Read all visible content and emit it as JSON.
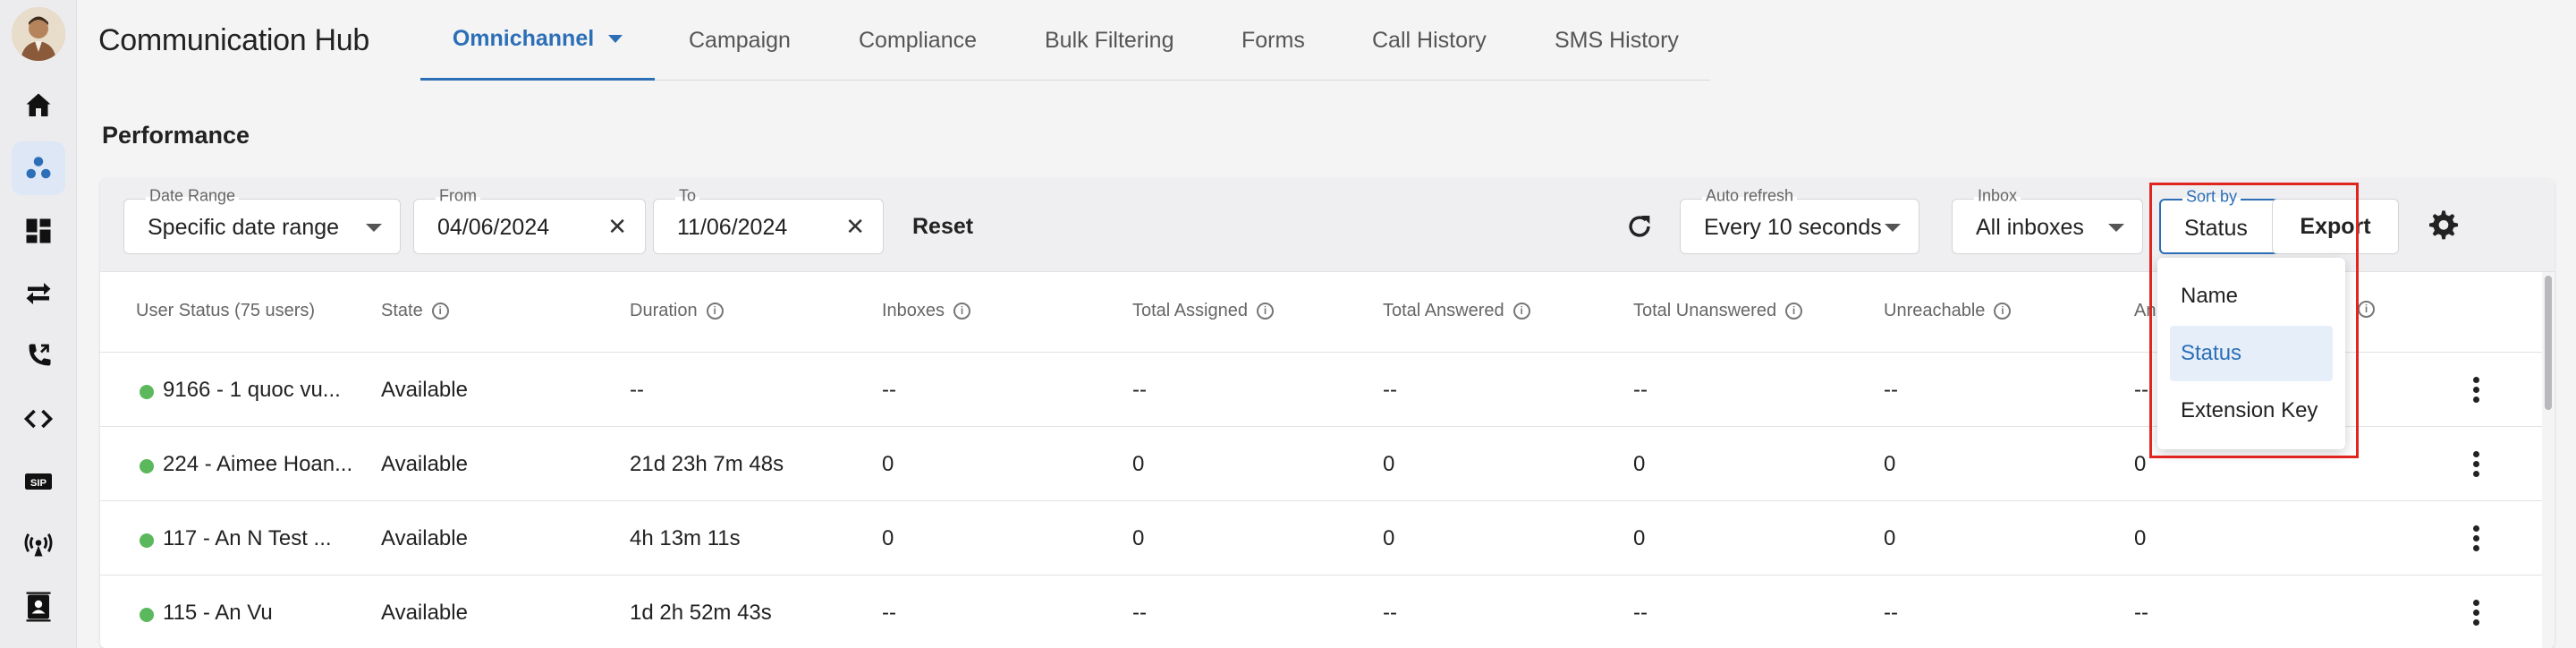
{
  "app": {
    "title": "Communication Hub"
  },
  "tabs": [
    {
      "label": "Omnichannel",
      "active": true
    },
    {
      "label": "Campaign"
    },
    {
      "label": "Compliance"
    },
    {
      "label": "Bulk Filtering"
    },
    {
      "label": "Forms"
    },
    {
      "label": "Call History"
    },
    {
      "label": "SMS History"
    }
  ],
  "sidebar": {
    "items": [
      {
        "icon": "home-icon"
      },
      {
        "icon": "omnichannel-icon",
        "active": true
      },
      {
        "icon": "dashboard-icon"
      },
      {
        "icon": "transfer-icon"
      },
      {
        "icon": "phone-forward-icon"
      },
      {
        "icon": "code-icon"
      },
      {
        "icon": "sip-icon",
        "text": "SIP"
      },
      {
        "icon": "broadcast-icon"
      },
      {
        "icon": "contacts-icon"
      }
    ]
  },
  "section": {
    "title": "Performance"
  },
  "filters": {
    "date_range": {
      "label": "Date Range",
      "value": "Specific date range"
    },
    "from": {
      "label": "From",
      "value": "04/06/2024"
    },
    "to": {
      "label": "To",
      "value": "11/06/2024"
    },
    "reset_label": "Reset",
    "auto_refresh": {
      "label": "Auto refresh",
      "value": "Every 10 seconds"
    },
    "inbox": {
      "label": "Inbox",
      "value": "All inboxes"
    },
    "sort_by": {
      "label": "Sort by",
      "value": "Status"
    },
    "export_label": "Export"
  },
  "sort_menu": {
    "options": [
      "Name",
      "Status",
      "Extension Key"
    ],
    "selected": "Status"
  },
  "table": {
    "headers": [
      "User Status (75 users)",
      "State",
      "Duration",
      "Inboxes",
      "Total Assigned",
      "Total Answered",
      "Total Unanswered",
      "Unreachable",
      "An"
    ],
    "rows": [
      {
        "user": "9166 - 1 quoc vu...",
        "state": "Available",
        "duration": "--",
        "inboxes": "--",
        "assigned": "--",
        "answered": "--",
        "unanswered": "--",
        "unreachable": "--",
        "an": "--"
      },
      {
        "user": "224 - Aimee Hoan...",
        "state": "Available",
        "duration": "21d 23h 7m 48s",
        "inboxes": "0",
        "assigned": "0",
        "answered": "0",
        "unanswered": "0",
        "unreachable": "0",
        "an": "0"
      },
      {
        "user": "117 - An N Test ...",
        "state": "Available",
        "duration": "4h 13m 11s",
        "inboxes": "0",
        "assigned": "0",
        "answered": "0",
        "unanswered": "0",
        "unreachable": "0",
        "an": "0"
      },
      {
        "user": "115 - An Vu",
        "state": "Available",
        "duration": "1d 2h 52m 43s",
        "inboxes": "--",
        "assigned": "--",
        "answered": "--",
        "unanswered": "--",
        "unreachable": "--",
        "an": "--"
      }
    ]
  },
  "colors": {
    "accent": "#2c6fb7",
    "status_available": "#5cb85c",
    "highlight": "#e0251f"
  }
}
